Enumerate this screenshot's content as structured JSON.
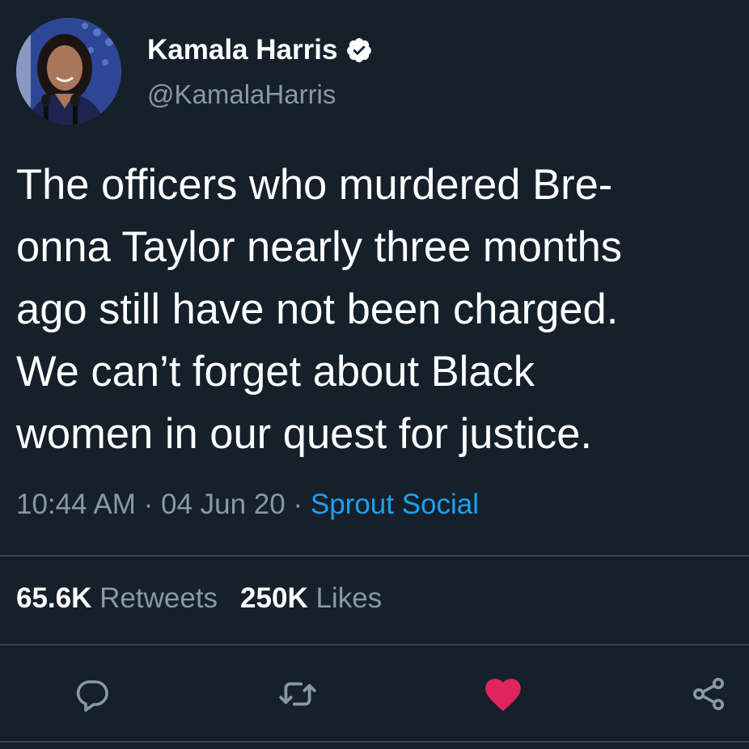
{
  "author": {
    "display_name": "Kamala Harris",
    "handle": "@KamalaHarris",
    "verified": true,
    "avatar_icon": "profile-photo"
  },
  "tweet": {
    "text_lines": [
      "The officers who murdered Bre-",
      "onna Taylor nearly three months",
      "ago still have not been charged.",
      "We can’t forget about Black",
      "women in our quest for justice."
    ],
    "time": "10:44 AM",
    "separator": " · ",
    "date": "04 Jun 20",
    "source": "Sprout Social"
  },
  "stats": {
    "retweets_count": "65.6K",
    "retweets_label": "Retweets",
    "likes_count": "250K",
    "likes_label": "Likes"
  },
  "actions": {
    "reply_icon": "reply-icon",
    "retweet_icon": "retweet-icon",
    "like_icon": "heart-icon",
    "share_icon": "share-icon",
    "liked": true
  },
  "colors": {
    "background": "#15202b",
    "secondary_text": "#8899a6",
    "link": "#1da1f2",
    "like": "#e0245e",
    "divider": "#38444d"
  }
}
